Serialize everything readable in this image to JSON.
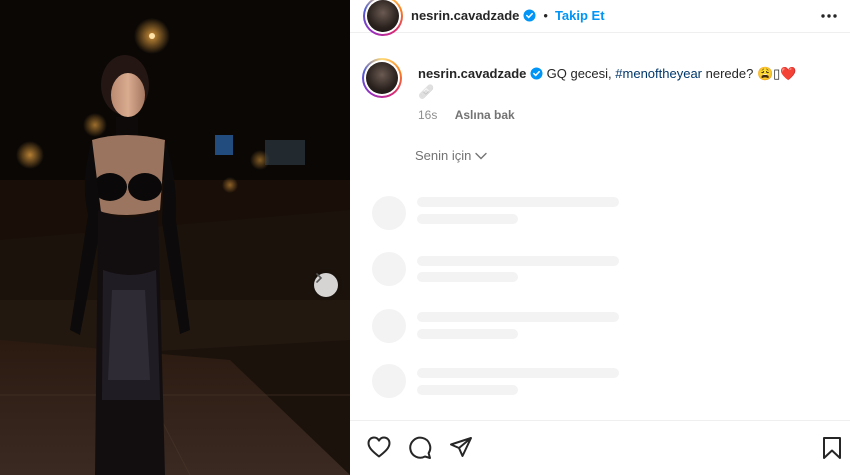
{
  "post": {
    "username": "nesrin.cavadzade",
    "separator": "•",
    "follow_label": "Takip Et",
    "caption_text": "GQ gecesi, ",
    "caption_hashtag": "#menoftheyear",
    "caption_end": " nerede? 😩▯❤️",
    "caption_line2": "🩹",
    "time": "16s",
    "see_translation": "Aslına bak",
    "for_you": "Senin için"
  },
  "icons": {
    "verified": "verified-badge-icon",
    "more": "more-options-icon",
    "next": "chevron-right-icon",
    "like": "heart-icon",
    "comment": "comment-icon",
    "share": "send-icon",
    "save": "bookmark-icon"
  },
  "colors": {
    "follow": "#0095f6",
    "hashtag": "#00376b",
    "verified": "#0095f6"
  }
}
